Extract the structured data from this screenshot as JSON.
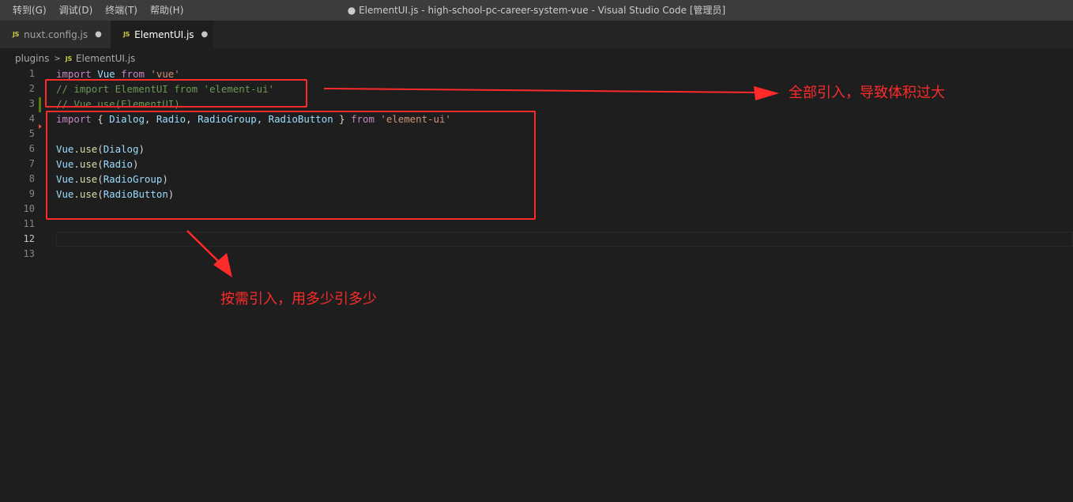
{
  "menu": [
    "转到(G)",
    "调试(D)",
    "终端(T)",
    "帮助(H)"
  ],
  "window_title": "● ElementUI.js - high-school-pc-career-system-vue - Visual Studio Code [管理员]",
  "tabs": [
    {
      "badge": "JS",
      "label": "nuxt.config.js",
      "dot": "●"
    },
    {
      "badge": "JS",
      "label": "ElementUI.js",
      "dot": "●"
    }
  ],
  "breadcrumb": {
    "folder": "plugins",
    "separator": ">",
    "badge": "JS",
    "file": "ElementUI.js"
  },
  "editor": {
    "line_numbers": [
      "1",
      "2",
      "3",
      "4",
      "5",
      "6",
      "7",
      "8",
      "9",
      "10",
      "11",
      "12",
      "13"
    ],
    "current_line": "12"
  },
  "code": {
    "l1": {
      "import": "import",
      "name": "Vue",
      "from": "from",
      "module": "'vue'"
    },
    "l2": "// import ElementUI from 'element-ui'",
    "l3": "// Vue.use(ElementUI)",
    "l4": {
      "import": "import",
      "open": "{ ",
      "a": "Dialog",
      "c1": ", ",
      "b": "Radio",
      "c2": ", ",
      "c": "RadioGroup",
      "c3": ", ",
      "d": "RadioButton",
      "close": " } ",
      "from": "from",
      "module": "'element-ui'"
    },
    "uses": [
      {
        "obj": "Vue",
        "dot": ".",
        "fn": "use",
        "open": "(",
        "arg": "Dialog",
        "close": ")"
      },
      {
        "obj": "Vue",
        "dot": ".",
        "fn": "use",
        "open": "(",
        "arg": "Radio",
        "close": ")"
      },
      {
        "obj": "Vue",
        "dot": ".",
        "fn": "use",
        "open": "(",
        "arg": "RadioGroup",
        "close": ")"
      },
      {
        "obj": "Vue",
        "dot": ".",
        "fn": "use",
        "open": "(",
        "arg": "RadioButton",
        "close": ")"
      }
    ]
  },
  "annotations": {
    "full_import": "全部引入，导致体积过大",
    "on_demand": "按需引入，用多少引多少",
    "color": "#ff2a2a"
  },
  "colors": {
    "keyword": "#c586c0",
    "variable": "#9cdcfe",
    "string": "#ce9178",
    "function": "#dcdcaa",
    "comment": "#6a9955",
    "background": "#1e1e1e"
  }
}
